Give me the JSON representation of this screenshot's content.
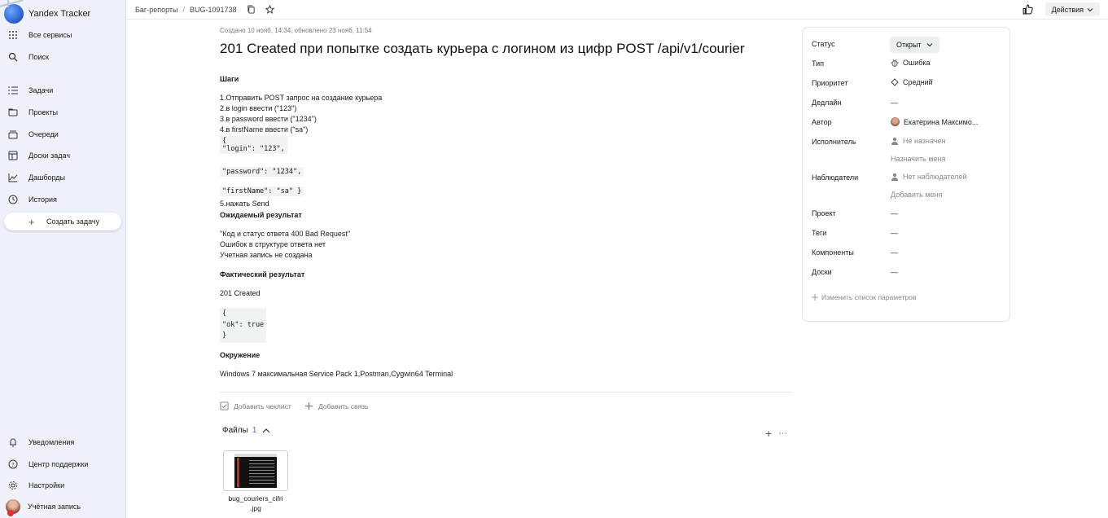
{
  "app": {
    "title": "Yandex Tracker"
  },
  "sidebar": {
    "top": [
      {
        "label": "Все сервисы",
        "icon": "grid-icon"
      },
      {
        "label": "Поиск",
        "icon": "search-icon"
      }
    ],
    "items": [
      {
        "label": "Задачи",
        "icon": "tasks-icon"
      },
      {
        "label": "Проекты",
        "icon": "projects-icon"
      },
      {
        "label": "Очереди",
        "icon": "queues-icon"
      },
      {
        "label": "Доски задач",
        "icon": "board-icon"
      },
      {
        "label": "Дашборды",
        "icon": "chart-icon"
      },
      {
        "label": "История",
        "icon": "clock-icon"
      }
    ],
    "create_label": "Создать задачу",
    "bottom": [
      {
        "label": "Уведомления",
        "icon": "bell-icon"
      },
      {
        "label": "Центр поддержки",
        "icon": "help-icon"
      },
      {
        "label": "Настройки",
        "icon": "gear-icon"
      },
      {
        "label": "Учётная запись",
        "icon": "avatar-icon"
      }
    ]
  },
  "header": {
    "breadcrumb": [
      "Баг-репорты",
      "BUG-1091738"
    ],
    "actions_label": "Действия"
  },
  "issue": {
    "meta": "Создано 10 нояб, 14:34, обновлено 23 нояб, 11:54",
    "title": "201 Created при попытке создать курьера с логином из цифр POST /api/v1/courier",
    "steps_h": "Шаги",
    "steps": [
      "1.Отправить POST запрос на создание курьера",
      "2.в login ввести (\"123\")",
      "3.в password ввести (\"1234\")",
      "4.в firstName ввести (\"sa\")"
    ],
    "code1": [
      "{",
      "\"login\": \"123\","
    ],
    "code2": "\"password\": \"1234\",",
    "code3": "\"firstName\": \"sa\" }",
    "step5": "5.нажать Send",
    "expected_h": "Ожидаемый результат",
    "expected": [
      "\"Код и статус ответа 400 Bad Request\"",
      "Ошибок в структуре ответа нет",
      "Учетная запись не создана"
    ],
    "actual_h": "Фактический результат",
    "actual": "201 Created",
    "actual_code": [
      "{",
      "\"ok\": true",
      "}"
    ],
    "env_h": "Окружение",
    "env": "Windows 7 максимальная Service Pack 1,Postman,Cygwin64 Terminal",
    "add_checklist": "Добавить чеклист",
    "add_link": "Добавить связь",
    "files_label": "Файлы",
    "files_count": "1",
    "file_name_1": "bug_couriers_cifri",
    "file_name_2": ".jpg"
  },
  "panel": {
    "status_label": "Статус",
    "status_value": "Открыт",
    "type_label": "Тип",
    "type_value": "Ошибка",
    "priority_label": "Приоритет",
    "priority_value": "Средний",
    "deadline_label": "Дедлайн",
    "deadline_value": "—",
    "author_label": "Автор",
    "author_value": "Екатерина Максимо...",
    "assignee_label": "Исполнитель",
    "assignee_value": "Не назначен",
    "assign_me": "Назначить меня",
    "watchers_label": "Наблюдатели",
    "watchers_value": "Нет наблюдателей",
    "add_me": "Добавить меня",
    "project_label": "Проект",
    "project_value": "—",
    "tags_label": "Теги",
    "tags_value": "—",
    "components_label": "Компоненты",
    "components_value": "—",
    "boards_label": "Доски",
    "boards_value": "—",
    "change_params": "Изменить список параметров"
  }
}
